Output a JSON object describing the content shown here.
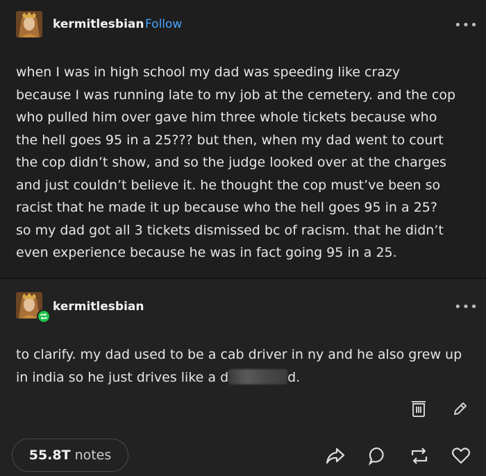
{
  "original_post": {
    "username": "kermitlesbian",
    "follow_label": "Follow",
    "more_label": "•••",
    "lines": [
      "when I was in high school my dad was speeding like crazy",
      "because I was running late to my job at the cemetery. and the cop",
      "who pulled him over gave him three whole tickets because who",
      "the hell goes 95 in a 25??? but then, when my dad went to court",
      "the cop didn’t show, and so the judge looked over at the charges",
      "and just couldn’t believe it. he thought the cop must’ve been so",
      "racist that he made it up because who the hell goes 95 in a 25?",
      "so my dad got all 3 tickets dismissed bc of racism. that he didn’t",
      "even experience because he was in fact going 95 in a 25."
    ]
  },
  "reblog": {
    "username": "kermitlesbian",
    "more_label": "•••",
    "line1": "to clarify. my dad used to be a cab driver in ny and he also grew up",
    "line2_before": "in india so he just drives like a d",
    "line2_after": "d."
  },
  "footer": {
    "notes_count": "55.8T",
    "notes_label": "notes",
    "icons": [
      "delete-icon",
      "edit-icon",
      "share-icon",
      "reply-icon",
      "reblog-icon",
      "like-icon"
    ]
  },
  "colors": {
    "background": "#212121",
    "follow": "#4aa3ff",
    "reblog_badge": "#1fc24a"
  }
}
